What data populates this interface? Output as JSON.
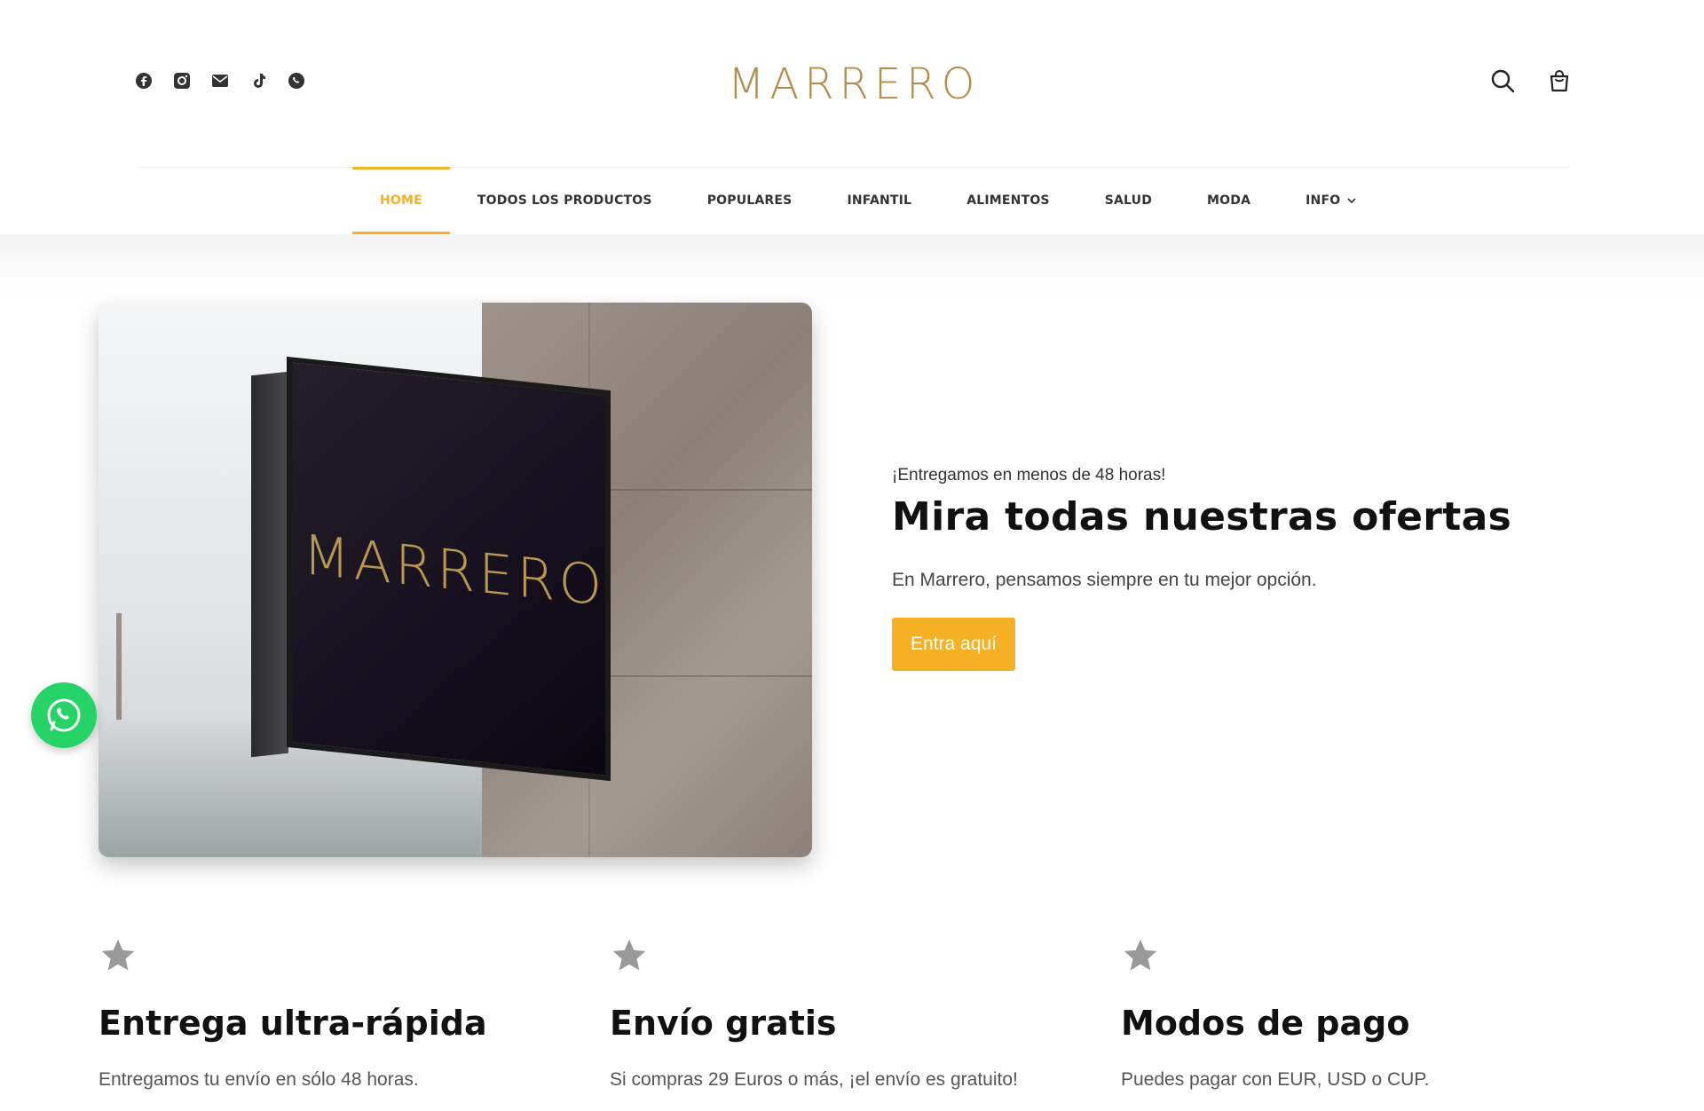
{
  "brand": {
    "logo_text": "MARRERO",
    "accent_color": "#f5b024",
    "logo_color": "#b78c4b"
  },
  "header": {
    "social_icons": [
      "facebook-icon",
      "instagram-icon",
      "email-icon",
      "tiktok-icon",
      "whatsapp-icon"
    ],
    "actions": [
      "search-icon",
      "cart-icon"
    ]
  },
  "nav": {
    "items": [
      {
        "label": "HOME",
        "active": true
      },
      {
        "label": "TODOS LOS PRODUCTOS"
      },
      {
        "label": "POPULARES"
      },
      {
        "label": "INFANTIL"
      },
      {
        "label": "ALIMENTOS"
      },
      {
        "label": "SALUD"
      },
      {
        "label": "MODA"
      },
      {
        "label": "INFO"
      }
    ]
  },
  "hero": {
    "sign_text": "MARRERO",
    "eyebrow": "¡Entregamos en menos de 48 horas!",
    "title": "Mira todas nuestras ofertas",
    "subtitle": "En Marrero, pensamos siempre en tu mejor opción.",
    "cta_label": "Entra aquí"
  },
  "features": [
    {
      "icon": "star-icon",
      "title": "Entrega ultra-rápida",
      "text": "Entregamos tu envío en sólo 48 horas."
    },
    {
      "icon": "star-icon",
      "title": "Envío gratis",
      "text": "Si compras 29 Euros o más, ¡el envío es gratuito!"
    },
    {
      "icon": "star-icon",
      "title": "Modos de pago",
      "text": "Puedes pagar con EUR, USD o CUP."
    }
  ]
}
